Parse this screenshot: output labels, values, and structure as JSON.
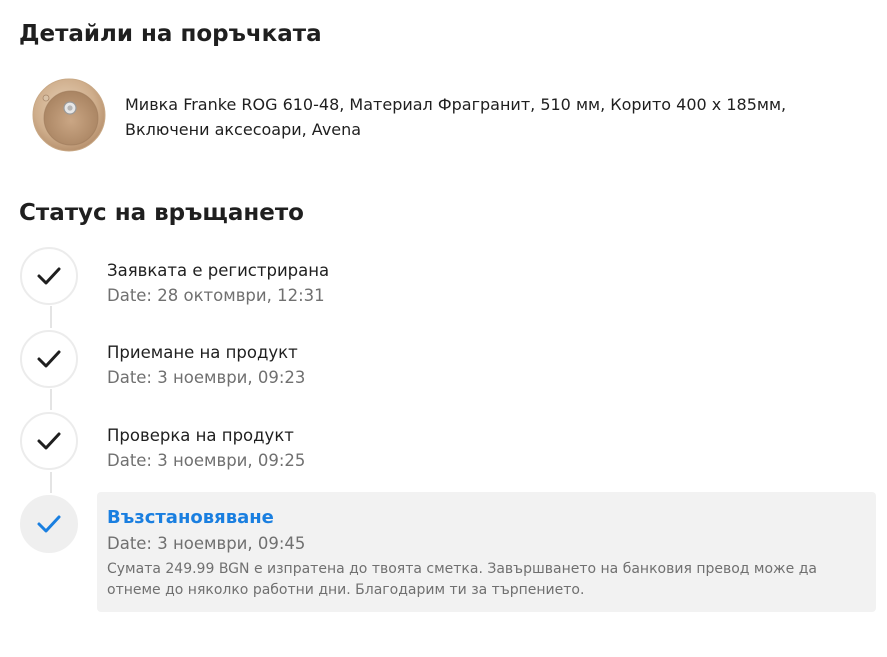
{
  "order": {
    "title": "Детайли на поръчката",
    "product_name": "Мивка Franke ROG 610-48, Материал Фрагранит, 510 мм, Корито 400 x 185мм, Включени аксесоари, Avena"
  },
  "return_status": {
    "title": "Статус на връщането",
    "steps": [
      {
        "title": "Заявката е регистрирана",
        "date": "Date: 28 октомври, 12:31",
        "state": "done"
      },
      {
        "title": "Приемане на продукт",
        "date": "Date: 3 ноември, 09:23",
        "state": "done"
      },
      {
        "title": "Проверка на продукт",
        "date": "Date: 3 ноември, 09:25",
        "state": "done"
      },
      {
        "title": "Възстановяване",
        "date": "Date: 3 ноември, 09:45",
        "description": "Сумата 249.99 BGN е изпратена до твоята сметка. Завършването на банковия превод може да отнеме до няколко работни дни. Благодарим ти за търпението.",
        "state": "active"
      }
    ]
  },
  "colors": {
    "accent": "#1a7fe0",
    "check_done": "#1f1f1f",
    "muted_text": "#707070",
    "panel_bg": "#f2f2f2"
  },
  "icons": {
    "step_done": "checkmark-icon",
    "step_active": "checkmark-icon",
    "product": "sink-thumbnail"
  }
}
